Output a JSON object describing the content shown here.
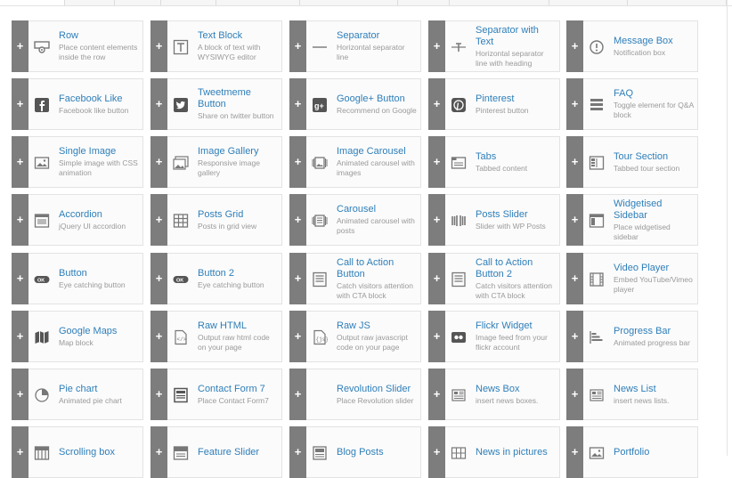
{
  "elements": [
    {
      "title": "Row",
      "desc": "Place content elements inside the row",
      "icon": "row-icon"
    },
    {
      "title": "Text Block",
      "desc": "A block of text with WYSIWYG editor",
      "icon": "text-block-icon"
    },
    {
      "title": "Separator",
      "desc": "Horizontal separator line",
      "icon": "separator-icon"
    },
    {
      "title": "Separator with Text",
      "desc": "Horizontal separator line with heading",
      "icon": "separator-text-icon"
    },
    {
      "title": "Message Box",
      "desc": "Notification box",
      "icon": "message-box-icon"
    },
    {
      "title": "Facebook Like",
      "desc": "Facebook like button",
      "icon": "facebook-icon"
    },
    {
      "title": "Tweetmeme Button",
      "desc": "Share on twitter button",
      "icon": "twitter-icon"
    },
    {
      "title": "Google+ Button",
      "desc": "Recommend on Google",
      "icon": "google-plus-icon"
    },
    {
      "title": "Pinterest",
      "desc": "Pinterest button",
      "icon": "pinterest-icon"
    },
    {
      "title": "FAQ",
      "desc": "Toggle element for Q&A block",
      "icon": "faq-icon"
    },
    {
      "title": "Single Image",
      "desc": "Simple image with CSS animation",
      "icon": "image-icon"
    },
    {
      "title": "Image Gallery",
      "desc": "Responsive image gallery",
      "icon": "gallery-icon"
    },
    {
      "title": "Image Carousel",
      "desc": "Animated carousel with images",
      "icon": "carousel-icon"
    },
    {
      "title": "Tabs",
      "desc": "Tabbed content",
      "icon": "tabs-icon"
    },
    {
      "title": "Tour Section",
      "desc": "Tabbed tour section",
      "icon": "tour-icon"
    },
    {
      "title": "Accordion",
      "desc": "jQuery UI accordion",
      "icon": "accordion-icon"
    },
    {
      "title": "Posts Grid",
      "desc": "Posts in grid view",
      "icon": "posts-grid-icon"
    },
    {
      "title": "Carousel",
      "desc": "Animated carousel with posts",
      "icon": "posts-carousel-icon"
    },
    {
      "title": "Posts Slider",
      "desc": "Slider with WP Posts",
      "icon": "posts-slider-icon"
    },
    {
      "title": "Widgetised Sidebar",
      "desc": "Place widgetised sidebar",
      "icon": "sidebar-icon"
    },
    {
      "title": "Button",
      "desc": "Eye catching button",
      "icon": "button-icon"
    },
    {
      "title": "Button 2",
      "desc": "Eye catching button",
      "icon": "button-icon"
    },
    {
      "title": "Call to Action Button",
      "desc": "Catch visitors attention with CTA block",
      "icon": "cta-icon"
    },
    {
      "title": "Call to Action Button 2",
      "desc": "Catch visitors attention with CTA block",
      "icon": "cta-icon"
    },
    {
      "title": "Video Player",
      "desc": "Embed YouTube/Vimeo player",
      "icon": "video-icon"
    },
    {
      "title": "Google Maps",
      "desc": "Map block",
      "icon": "map-icon"
    },
    {
      "title": "Raw HTML",
      "desc": "Output raw html code on your page",
      "icon": "raw-html-icon"
    },
    {
      "title": "Raw JS",
      "desc": "Output raw javascript code on your page",
      "icon": "raw-js-icon"
    },
    {
      "title": "Flickr Widget",
      "desc": "Image feed from your flickr account",
      "icon": "flickr-icon"
    },
    {
      "title": "Progress Bar",
      "desc": "Animated progress bar",
      "icon": "progress-bar-icon"
    },
    {
      "title": "Pie chart",
      "desc": "Animated pie chart",
      "icon": "pie-chart-icon"
    },
    {
      "title": "Contact Form 7",
      "desc": "Place Contact Form7",
      "icon": "contact-form-icon"
    },
    {
      "title": "Revolution Slider",
      "desc": "Place Revolution slider",
      "icon": ""
    },
    {
      "title": "News Box",
      "desc": "insert news boxes.",
      "icon": "news-icon"
    },
    {
      "title": "News List",
      "desc": "insert news lists.",
      "icon": "news-icon"
    },
    {
      "title": "Scrolling box",
      "desc": "",
      "icon": "scrolling-box-icon"
    },
    {
      "title": "Feature Slider",
      "desc": "",
      "icon": "feature-slider-icon"
    },
    {
      "title": "Blog Posts",
      "desc": "",
      "icon": "blog-posts-icon"
    },
    {
      "title": "News in pictures",
      "desc": "",
      "icon": "news-pictures-icon"
    },
    {
      "title": "Portfolio",
      "desc": "",
      "icon": "portfolio-icon"
    }
  ],
  "plus_label": "+"
}
